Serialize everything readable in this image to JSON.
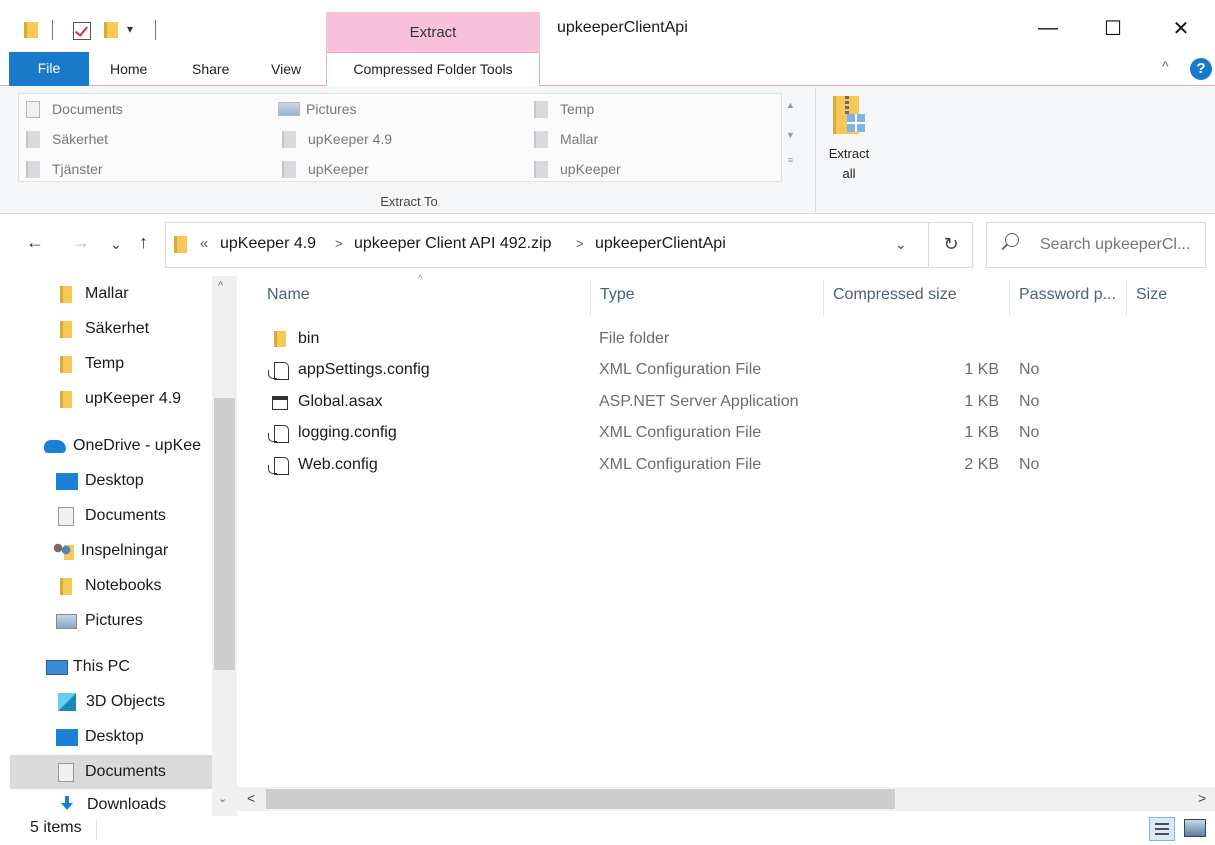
{
  "window": {
    "title": "upkeeperClientApi",
    "context_tab_header": "Extract",
    "controls": {
      "minimize": "—",
      "maximize": "☐",
      "close": "✕"
    }
  },
  "quick_access": {
    "dropdown": "▾"
  },
  "ribbon_tabs": {
    "file": "File",
    "home": "Home",
    "share": "Share",
    "view": "View",
    "compressed": "Compressed Folder Tools",
    "collapse": "^",
    "help": "?"
  },
  "extract_to": {
    "group_label": "Extract To",
    "items": [
      {
        "label": "Documents",
        "icon": "documents-icon"
      },
      {
        "label": "Säkerhet",
        "icon": "folder-icon"
      },
      {
        "label": "Tjänster",
        "icon": "folder-icon"
      },
      {
        "label": "Pictures",
        "icon": "pictures-icon"
      },
      {
        "label": "upKeeper 4.9",
        "icon": "folder-icon"
      },
      {
        "label": "upKeeper",
        "icon": "folder-icon"
      },
      {
        "label": "Temp",
        "icon": "folder-icon"
      },
      {
        "label": "Mallar",
        "icon": "folder-icon"
      },
      {
        "label": "upKeeper",
        "icon": "folder-icon"
      }
    ],
    "extract_all_line1": "Extract",
    "extract_all_line2": "all"
  },
  "address": {
    "overflow": "«",
    "crumbs": [
      "upKeeper 4.9",
      "upkeeper Client API 492.zip",
      "upkeeperClientApi"
    ],
    "separator": ">",
    "dropdown": "⌄",
    "refresh": "↻"
  },
  "nav_buttons": {
    "back": "←",
    "forward": "→",
    "recent": "⌄",
    "up": "↑"
  },
  "search": {
    "placeholder": "Search upkeeperCl..."
  },
  "nav_pane": {
    "scroll_up": "^",
    "scroll_down": "⌄",
    "items": [
      {
        "label": "Mallar",
        "icon": "folder-icon"
      },
      {
        "label": "Säkerhet",
        "icon": "folder-icon"
      },
      {
        "label": "Temp",
        "icon": "folder-icon"
      },
      {
        "label": "upKeeper 4.9",
        "icon": "folder-icon"
      },
      {
        "label": "OneDrive - upKee",
        "icon": "onedrive-cloud-icon"
      },
      {
        "label": "Desktop",
        "icon": "desktop-icon"
      },
      {
        "label": "Documents",
        "icon": "documents-icon"
      },
      {
        "label": "Inspelningar",
        "icon": "shared-folder-icon"
      },
      {
        "label": "Notebooks",
        "icon": "folder-icon"
      },
      {
        "label": "Pictures",
        "icon": "pictures-icon"
      },
      {
        "label": "This PC",
        "icon": "this-pc-icon"
      },
      {
        "label": "3D Objects",
        "icon": "3d-objects-icon"
      },
      {
        "label": "Desktop",
        "icon": "desktop-icon"
      },
      {
        "label": "Documents",
        "icon": "documents-icon",
        "selected": true
      },
      {
        "label": "Downloads",
        "icon": "downloads-icon"
      }
    ]
  },
  "file_list": {
    "sort_indicator": "^",
    "columns": {
      "name": "Name",
      "type": "Type",
      "compressed_size": "Compressed size",
      "password": "Password p...",
      "size": "Size"
    },
    "rows": [
      {
        "name": "bin",
        "type": "File folder",
        "compressed_size": "",
        "password": "",
        "icon": "folder-icon"
      },
      {
        "name": "appSettings.config",
        "type": "XML Configuration File",
        "compressed_size": "1 KB",
        "password": "No",
        "icon": "config-file-icon"
      },
      {
        "name": "Global.asax",
        "type": "ASP.NET Server Application",
        "compressed_size": "1 KB",
        "password": "No",
        "icon": "asax-file-icon"
      },
      {
        "name": "logging.config",
        "type": "XML Configuration File",
        "compressed_size": "1 KB",
        "password": "No",
        "icon": "config-file-icon"
      },
      {
        "name": "Web.config",
        "type": "XML Configuration File",
        "compressed_size": "2 KB",
        "password": "No",
        "icon": "config-file-icon"
      }
    ]
  },
  "hscroll": {
    "left": "<",
    "right": ">"
  },
  "status": {
    "item_count": "5 items"
  },
  "colors": {
    "accent": "#1979ca",
    "context_tab": "#f8c1da",
    "folder": "#f6c857"
  }
}
